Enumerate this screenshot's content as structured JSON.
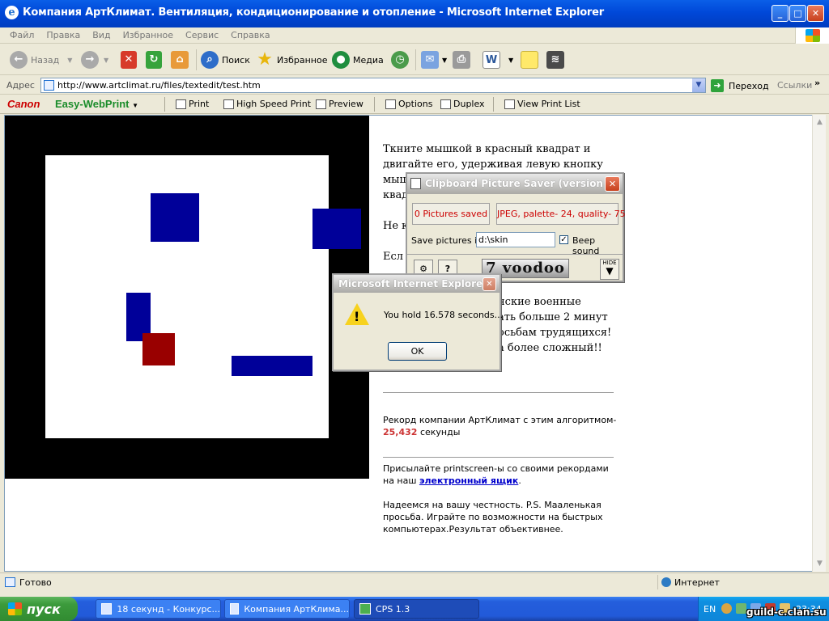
{
  "window": {
    "title": "Компания АртКлимат. Вентиляция, кондиционирование и отопление - Microsoft Internet Explorer"
  },
  "menu": [
    "Файл",
    "Правка",
    "Вид",
    "Избранное",
    "Сервис",
    "Справка"
  ],
  "toolbar": {
    "back": "Назад",
    "search": "Поиск",
    "favorites": "Избранное",
    "media": "Медиа"
  },
  "address": {
    "label": "Адрес",
    "url": "http://www.artclimat.ru/files/textedit/test.htm",
    "go": "Переход",
    "links": "Ссылки"
  },
  "canon": {
    "logo": "Canon",
    "product": "Easy-WebPrint",
    "print": "Print",
    "high_speed": "High Speed Print",
    "preview": "Preview",
    "options": "Options",
    "duplex": "Duplex",
    "view_list": "View Print List"
  },
  "page": {
    "para1": "Ткните мышкой в красный квадрат и двигайте его, удерживая левую кнопку мыш",
    "para1b": "квад",
    "para2": "Не к",
    "para3": "Есл",
    "para4a": "нские военные",
    "para4b": "ать больше 2 минут",
    "para4c": "осьбам трудящихся!",
    "para4d": "а более сложный!!",
    "record_text": "Рекорд компании АртКлимат с этим алгоритмом-",
    "record_value": "25,432",
    "record_unit": "секунды",
    "send_text": "Присылайте printscreen-ы со своими рекордами на наш",
    "send_link": "электронный ящик",
    "send_end": ".",
    "honest": "Надеемся на вашу честность. P.S. Мааленькая просьба. Играйте по возможности на быстрых компьютерах.Результат объективнее."
  },
  "status": {
    "text": "Готово",
    "zone": "Интернет"
  },
  "cps": {
    "title": "Clipboard Picture Saver (version...",
    "saved": "0 Pictures saved",
    "format": "JPEG, palette- 24, quality- 75",
    "save_label": "Save pictures in",
    "path": "d:\\skin",
    "beep": "Beep sound",
    "beep_checked": true,
    "logo": "7 voodoo",
    "hide": "HIDE"
  },
  "alert": {
    "title": "Microsoft Internet Explorer",
    "message": "You hold 16.578 seconds...",
    "ok": "OK"
  },
  "taskbar": {
    "start": "пуск",
    "tasks": [
      "18 секунд - Конкурс...",
      "Компания АртКлима...",
      "CPS 1.3"
    ],
    "lang": "EN",
    "clock": "23:34"
  },
  "watermark": "guild-c.clan.su"
}
